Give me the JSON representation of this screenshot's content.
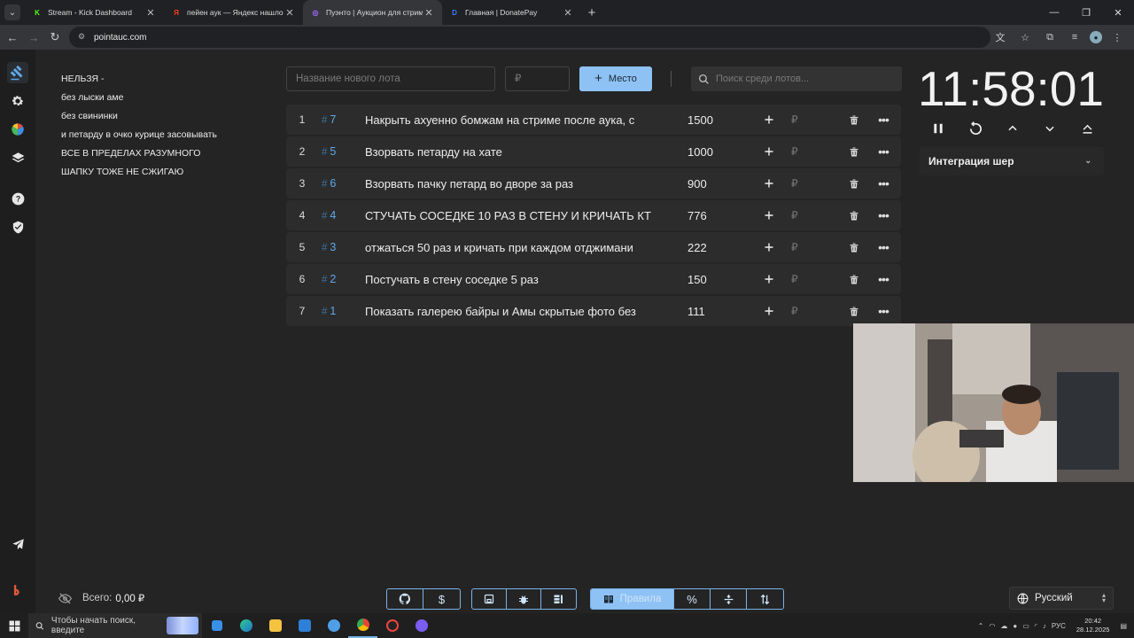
{
  "browser": {
    "tabs": [
      {
        "title": "Stream - Kick Dashboard",
        "favicon": "K",
        "color": "#53fc18"
      },
      {
        "title": "пейен аук — Яндекс нашлось",
        "favicon": "Я",
        "color": "#fc3f1d"
      },
      {
        "title": "Пуэнто | Аукцион для стримеров",
        "favicon": "◎",
        "color": "#a56bff"
      },
      {
        "title": "Главная | DonatePay",
        "favicon": "D",
        "color": "#3c7bf6"
      }
    ],
    "url": "pointauc.com"
  },
  "rules": {
    "lines": [
      "НЕЛЬЗЯ -",
      "без лыски аме",
      "без свининки",
      "и петарду в очко курице засовывать",
      "ВСЕ В ПРЕДЕЛАХ РАЗУМНОГО",
      "ШАПКУ ТОЖЕ НЕ СЖИГАЮ"
    ]
  },
  "controls": {
    "lot_placeholder": "Название нового лота",
    "price_placeholder": "₽",
    "add_label": "Место",
    "search_placeholder": "Поиск среди лотов..."
  },
  "lots": [
    {
      "num": "1",
      "id": "7",
      "name": "Накрыть ахуенно бомжам на стриме после аука, с",
      "amount": "1500"
    },
    {
      "num": "2",
      "id": "5",
      "name": "Взорвать петарду на хате",
      "amount": "1000"
    },
    {
      "num": "3",
      "id": "6",
      "name": "Взорвать пачку петард во дворе за раз",
      "amount": "900"
    },
    {
      "num": "4",
      "id": "4",
      "name": "СТУЧАТЬ СОСЕДКЕ 10 РАЗ В СТЕНУ И КРИЧАТЬ КТ",
      "amount": "776"
    },
    {
      "num": "5",
      "id": "3",
      "name": "отжаться 50 раз и кричать при каждом отджимани",
      "amount": "222"
    },
    {
      "num": "6",
      "id": "2",
      "name": "Постучать в стену соседке 5 раз",
      "amount": "150"
    },
    {
      "num": "7",
      "id": "1",
      "name": "Показать галерею байры и Амы скрытые фото без",
      "amount": "111"
    }
  ],
  "lot_currency": "₽",
  "lot_hash": "#",
  "timer": {
    "time": "11:58:01"
  },
  "integration": {
    "label": "Интеграция шер"
  },
  "footer": {
    "total_label": "Всего:",
    "total_value": "0,00 ₽",
    "rules_label": "Правила",
    "language": "Русский"
  },
  "taskbar": {
    "search_placeholder": "Чтобы начать поиск, введите",
    "lang": "РУС",
    "time": "20:42",
    "date": "28.12.2025"
  },
  "colors": {
    "accent": "#8ec2f5",
    "lot_id": "#5ea8e8",
    "background": "#242424",
    "row": "#2c2c2c"
  }
}
